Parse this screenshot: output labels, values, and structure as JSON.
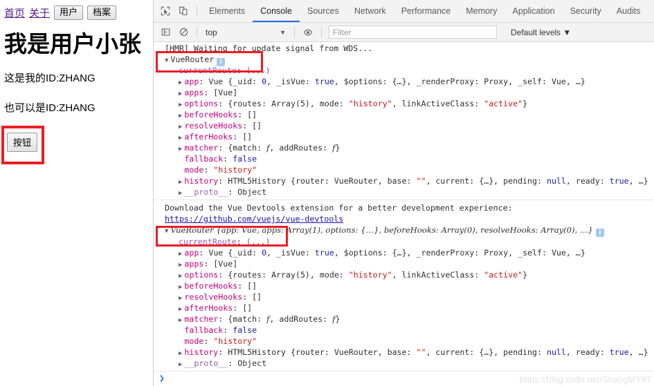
{
  "page": {
    "nav": [
      {
        "label": "首页",
        "type": "link"
      },
      {
        "label": "关于",
        "type": "link"
      },
      {
        "label": "用户",
        "type": "button"
      },
      {
        "label": "档案",
        "type": "button"
      }
    ],
    "title": "我是用户小张",
    "lines": [
      "这是我的ID:ZHANG",
      "也可以是ID:ZHANG"
    ],
    "action_button": "按钮",
    "highlight_color": "#ed1c24"
  },
  "devtools": {
    "toolbar_icons": [
      {
        "name": "inspect-element-icon"
      },
      {
        "name": "device-toolbar-icon"
      }
    ],
    "tabs": [
      {
        "label": "Elements",
        "active": false
      },
      {
        "label": "Console",
        "active": true
      },
      {
        "label": "Sources",
        "active": false
      },
      {
        "label": "Network",
        "active": false
      },
      {
        "label": "Performance",
        "active": false
      },
      {
        "label": "Memory",
        "active": false
      },
      {
        "label": "Application",
        "active": false
      },
      {
        "label": "Security",
        "active": false
      },
      {
        "label": "Audits",
        "active": false
      }
    ],
    "active_tab_accent": "#1a73e8",
    "subbar": {
      "sidebar_toggle_icon": "console-sidebar-icon",
      "clear_icon": "clear-console-icon",
      "context_value": "top",
      "context_caret": "▼",
      "eye_icon": "live-expression-icon",
      "filter_placeholder": "Filter",
      "filter_value": "",
      "levels_label": "Default levels",
      "levels_caret": "▼"
    },
    "console": {
      "hmr_message": "[HMR] Waiting for update signal from WDS...",
      "block1": {
        "header_label": "VueRouter",
        "header_arrow": "▼",
        "info_badge": "i",
        "currentRoute": {
          "key": "currentRoute",
          "value": "(...)"
        },
        "props": [
          {
            "arrow": "▶",
            "key": "app",
            "value": "Vue {_uid: 0, _isVue: true, $options: {…}, _renderProxy: Proxy, _self: Vue, …}"
          },
          {
            "arrow": "▶",
            "key": "apps",
            "value": "[Vue]"
          },
          {
            "arrow": "▶",
            "key": "options",
            "value": "{routes: Array(5), mode: \"history\", linkActiveClass: \"active\"}"
          },
          {
            "arrow": "▶",
            "key": "beforeHooks",
            "value": "[]"
          },
          {
            "arrow": "▶",
            "key": "resolveHooks",
            "value": "[]"
          },
          {
            "arrow": "▶",
            "key": "afterHooks",
            "value": "[]"
          },
          {
            "arrow": "▶",
            "key": "matcher",
            "value": "{match: f, addRoutes: f}"
          },
          {
            "arrow": "",
            "key": "fallback",
            "value": "false"
          },
          {
            "arrow": "",
            "key": "mode",
            "value": "\"history\""
          },
          {
            "arrow": "▶",
            "key": "history",
            "value": "HTML5History {router: VueRouter, base: \"\", current: {…}, pending: null, ready: true, …}"
          },
          {
            "arrow": "▶",
            "key": "__proto__",
            "value": "Object"
          }
        ]
      },
      "devtools_notice": "Download the Vue Devtools extension for a better development experience:",
      "devtools_url": "https://github.com/vuejs/vue-devtools",
      "block2": {
        "header_arrow": "▼",
        "header_label": "VueRouter",
        "header_preview": "{app: Vue, apps: Array(1), options: {…}, beforeHooks: Array(0), resolveHooks: Array(0), …}",
        "info_badge": "i",
        "currentRoute": {
          "key": "currentRoute",
          "value": "(...)"
        },
        "props": [
          {
            "arrow": "▶",
            "key": "app",
            "value": "Vue {_uid: 0, _isVue: true, $options: {…}, _renderProxy: Proxy, _self: Vue, …}"
          },
          {
            "arrow": "▶",
            "key": "apps",
            "value": "[Vue]"
          },
          {
            "arrow": "▶",
            "key": "options",
            "value": "{routes: Array(5), mode: \"history\", linkActiveClass: \"active\"}"
          },
          {
            "arrow": "▶",
            "key": "beforeHooks",
            "value": "[]"
          },
          {
            "arrow": "▶",
            "key": "resolveHooks",
            "value": "[]"
          },
          {
            "arrow": "▶",
            "key": "afterHooks",
            "value": "[]"
          },
          {
            "arrow": "▶",
            "key": "matcher",
            "value": "{match: f, addRoutes: f}"
          },
          {
            "arrow": "",
            "key": "fallback",
            "value": "false"
          },
          {
            "arrow": "",
            "key": "mode",
            "value": "\"history\""
          },
          {
            "arrow": "▶",
            "key": "history",
            "value": "HTML5History {router: VueRouter, base: \"\", current: {…}, pending: null, ready: true, …}"
          },
          {
            "arrow": "▶",
            "key": "__proto__",
            "value": "Object"
          }
        ]
      },
      "prompt_caret": "❯"
    }
  },
  "watermark": "https://blog.csdn.net/ShangMY97"
}
